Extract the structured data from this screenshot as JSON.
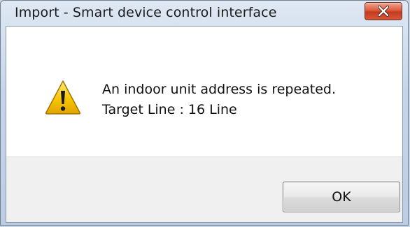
{
  "window": {
    "title": "Import - Smart device control interface"
  },
  "titlebar": {
    "close_icon": "close-x-icon",
    "close_color": "#c9452a"
  },
  "message": {
    "icon": "warning-icon",
    "icon_color": "#f5c400",
    "line1": "An indoor unit address is repeated.",
    "line2": "Target Line : 16 Line"
  },
  "buttons": {
    "ok_label": "OK"
  }
}
